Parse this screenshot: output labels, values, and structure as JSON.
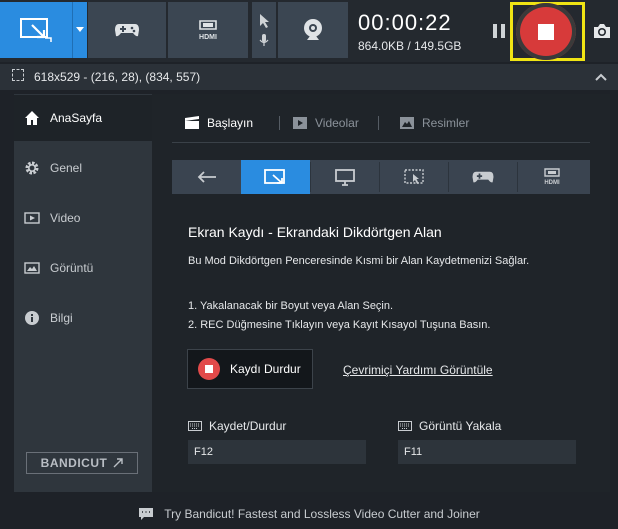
{
  "toolbar": {
    "timer": "00:00:22",
    "file_info": "864.0KB / 149.5GB",
    "modes": [
      "screen-rectangle-icon",
      "dropdown-arrow-icon",
      "gamepad-icon",
      "hdmi-icon",
      "cursor-icon",
      "mic-icon",
      "webcam-icon"
    ],
    "hdmi_text": "HDMI",
    "record_color": "#d73a3a",
    "highlight_color": "#f0e414"
  },
  "area": {
    "text": "618x529 - (216, 28), (834, 557)"
  },
  "sidebar": {
    "items": [
      {
        "label": "AnaSayfa",
        "icon": "home-icon",
        "active": true
      },
      {
        "label": "Genel",
        "icon": "gear-icon",
        "active": false
      },
      {
        "label": "Video",
        "icon": "video-icon",
        "active": false
      },
      {
        "label": "Görüntü",
        "icon": "image-icon",
        "active": false
      },
      {
        "label": "Bilgi",
        "icon": "info-icon",
        "active": false
      }
    ],
    "bandicut": "BANDICUT"
  },
  "main": {
    "tabs": [
      {
        "label": "Başlayın",
        "active": true
      },
      {
        "label": "Videolar",
        "active": false
      },
      {
        "label": "Resimler",
        "active": false
      }
    ],
    "mode_buttons": [
      "back-arrow-icon",
      "screen-rectangle-icon",
      "fullscreen-icon",
      "around-mouse-icon",
      "gamepad-icon",
      "hdmi-icon"
    ],
    "hdmi_text": "HDMI",
    "accent_color": "#2a8ce0",
    "title": "Ekran Kaydı - Ekrandaki Dikdörtgen Alan",
    "description": "Bu Mod Dikdörtgen Penceresinde Kısmi bir Alan Kaydetmenizi Sağlar.",
    "step1": "1. Yakalanacak bir Boyut veya Alan Seçin.",
    "step2": "2. REC Düğmesine Tıklayın veya Kayıt Kısayol Tuşuna Basın.",
    "stop_button": "Kaydı Durdur",
    "help_link": "Çevrimiçi Yardımı Görüntüle",
    "hotkeys": [
      {
        "label": "Kaydet/Durdur",
        "value": "F12"
      },
      {
        "label": "Görüntü Yakala",
        "value": "F11"
      }
    ]
  },
  "footer": {
    "text": "Try Bandicut! Fastest and Lossless Video Cutter and Joiner"
  }
}
